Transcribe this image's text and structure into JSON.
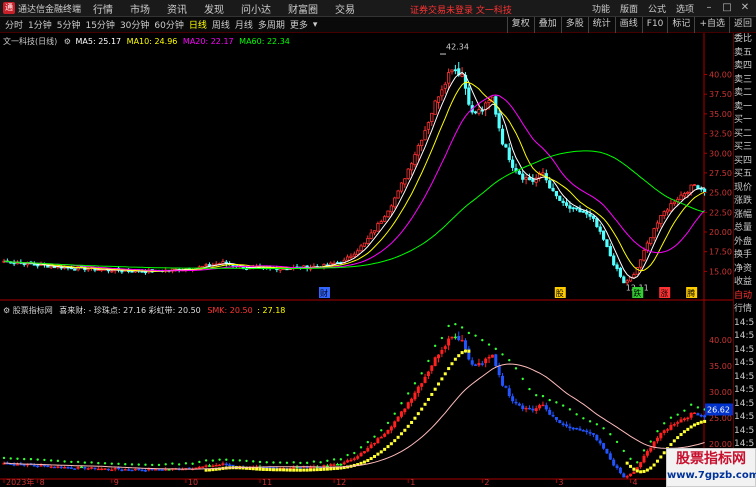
{
  "titlebar": {
    "app_title": "通达信金融终端",
    "menu": [
      "行情",
      "市场",
      "资讯",
      "发现",
      "问小达",
      "财富圈",
      "交易"
    ],
    "notice": "证券交易未登录  文一科技",
    "right_menu": [
      "功能",
      "版面",
      "公式",
      "选项"
    ]
  },
  "toolbar": {
    "periods": [
      "分时",
      "1分钟",
      "5分钟",
      "15分钟",
      "30分钟",
      "60分钟",
      "日线",
      "周线",
      "月线",
      "多周期",
      "更多"
    ],
    "active_period": "日线",
    "buttons": [
      "复权",
      "叠加",
      "多股",
      "统计",
      "画线",
      "F10",
      "标记",
      "+自选",
      "返回"
    ]
  },
  "main_legend": {
    "name": "文一科技(日线)",
    "ma5": "MA5: 25.17",
    "ma10": "MA10: 24.96",
    "ma20": "MA20: 22.17",
    "ma60": "MA60: 22.34"
  },
  "sub_legend": {
    "name": "股票指标网",
    "item1": "喜来财: - 珍珠点: 27.16 彩虹带: 20.50",
    "item2": "SMK: 20.50",
    "item3": ": 27.18"
  },
  "annotations": {
    "high": "42.34",
    "low": "12.11",
    "tag_cai": "财",
    "tag_gu": "股",
    "tag_die": "跌",
    "tag_zhang": "涨",
    "tag_teng": "腾",
    "current_price": "26.62"
  },
  "main_axis": [
    "40.00",
    "37.50",
    "35.00",
    "32.50",
    "30.00",
    "27.50",
    "25.00",
    "22.50",
    "20.00",
    "17.50",
    "15.00"
  ],
  "sub_axis": [
    "40.00",
    "35.00",
    "30.00",
    "25.00",
    "20.00"
  ],
  "x_axis": [
    "2023年",
    "8",
    "9",
    "10",
    "11",
    "12",
    "1",
    "2",
    "3",
    "4"
  ],
  "side_panel": [
    "委比",
    "卖五",
    "卖四",
    "卖三",
    "卖二",
    "卖一",
    "买一",
    "买二",
    "买三",
    "买四",
    "买五",
    "现价",
    "涨跌",
    "涨幅",
    "总量",
    "外盘",
    "换手",
    "净资",
    "收益",
    "自动",
    "行情",
    "14:5",
    "14:5",
    "14:5",
    "14:5",
    "14:5",
    "14:5",
    "14:5",
    "14:5",
    "14:5",
    "14:5",
    "14:5",
    "14:5",
    "14:5"
  ],
  "watermark": {
    "main": "股票指标网",
    "url": "www.7gpzb.com"
  },
  "colors": {
    "up": "#ff3232",
    "down": "#54ffff",
    "ma5": "#ffffff",
    "ma10": "#ffff00",
    "ma20": "#ff00ff",
    "ma60": "#00ff00"
  }
}
